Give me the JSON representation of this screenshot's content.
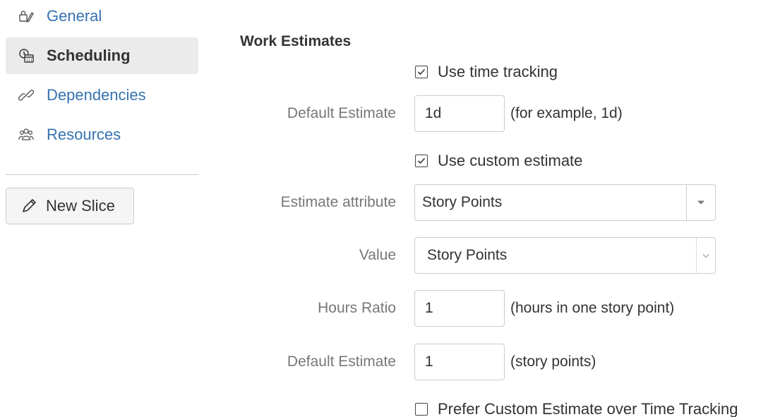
{
  "sidebar": {
    "items": [
      {
        "label": "General",
        "icon": "general-settings-icon",
        "active": false
      },
      {
        "label": "Scheduling",
        "icon": "calendar-clock-icon",
        "active": true
      },
      {
        "label": "Dependencies",
        "icon": "link-icon",
        "active": false
      },
      {
        "label": "Resources",
        "icon": "people-icon",
        "active": false
      }
    ],
    "new_slice_label": "New Slice"
  },
  "main": {
    "section_title": "Work Estimates",
    "use_time_tracking": {
      "label": "Use time tracking",
      "checked": true
    },
    "default_estimate_time": {
      "label": "Default Estimate",
      "value": "1d",
      "hint": "(for example, 1d)"
    },
    "use_custom_estimate": {
      "label": "Use custom estimate",
      "checked": true
    },
    "estimate_attribute": {
      "label": "Estimate attribute",
      "value": "Story Points"
    },
    "value_select": {
      "label": "Value",
      "value": "Story Points"
    },
    "hours_ratio": {
      "label": "Hours Ratio",
      "value": "1",
      "hint": "(hours in one story point)"
    },
    "default_estimate_points": {
      "label": "Default Estimate",
      "value": "1",
      "hint": "(story points)"
    },
    "prefer_custom": {
      "label": "Prefer Custom Estimate over Time Tracking",
      "checked": false
    }
  },
  "colors": {
    "link": "#3572b0",
    "active_bg": "#ebebeb",
    "label_gray": "#777777",
    "border": "#cccccc"
  }
}
